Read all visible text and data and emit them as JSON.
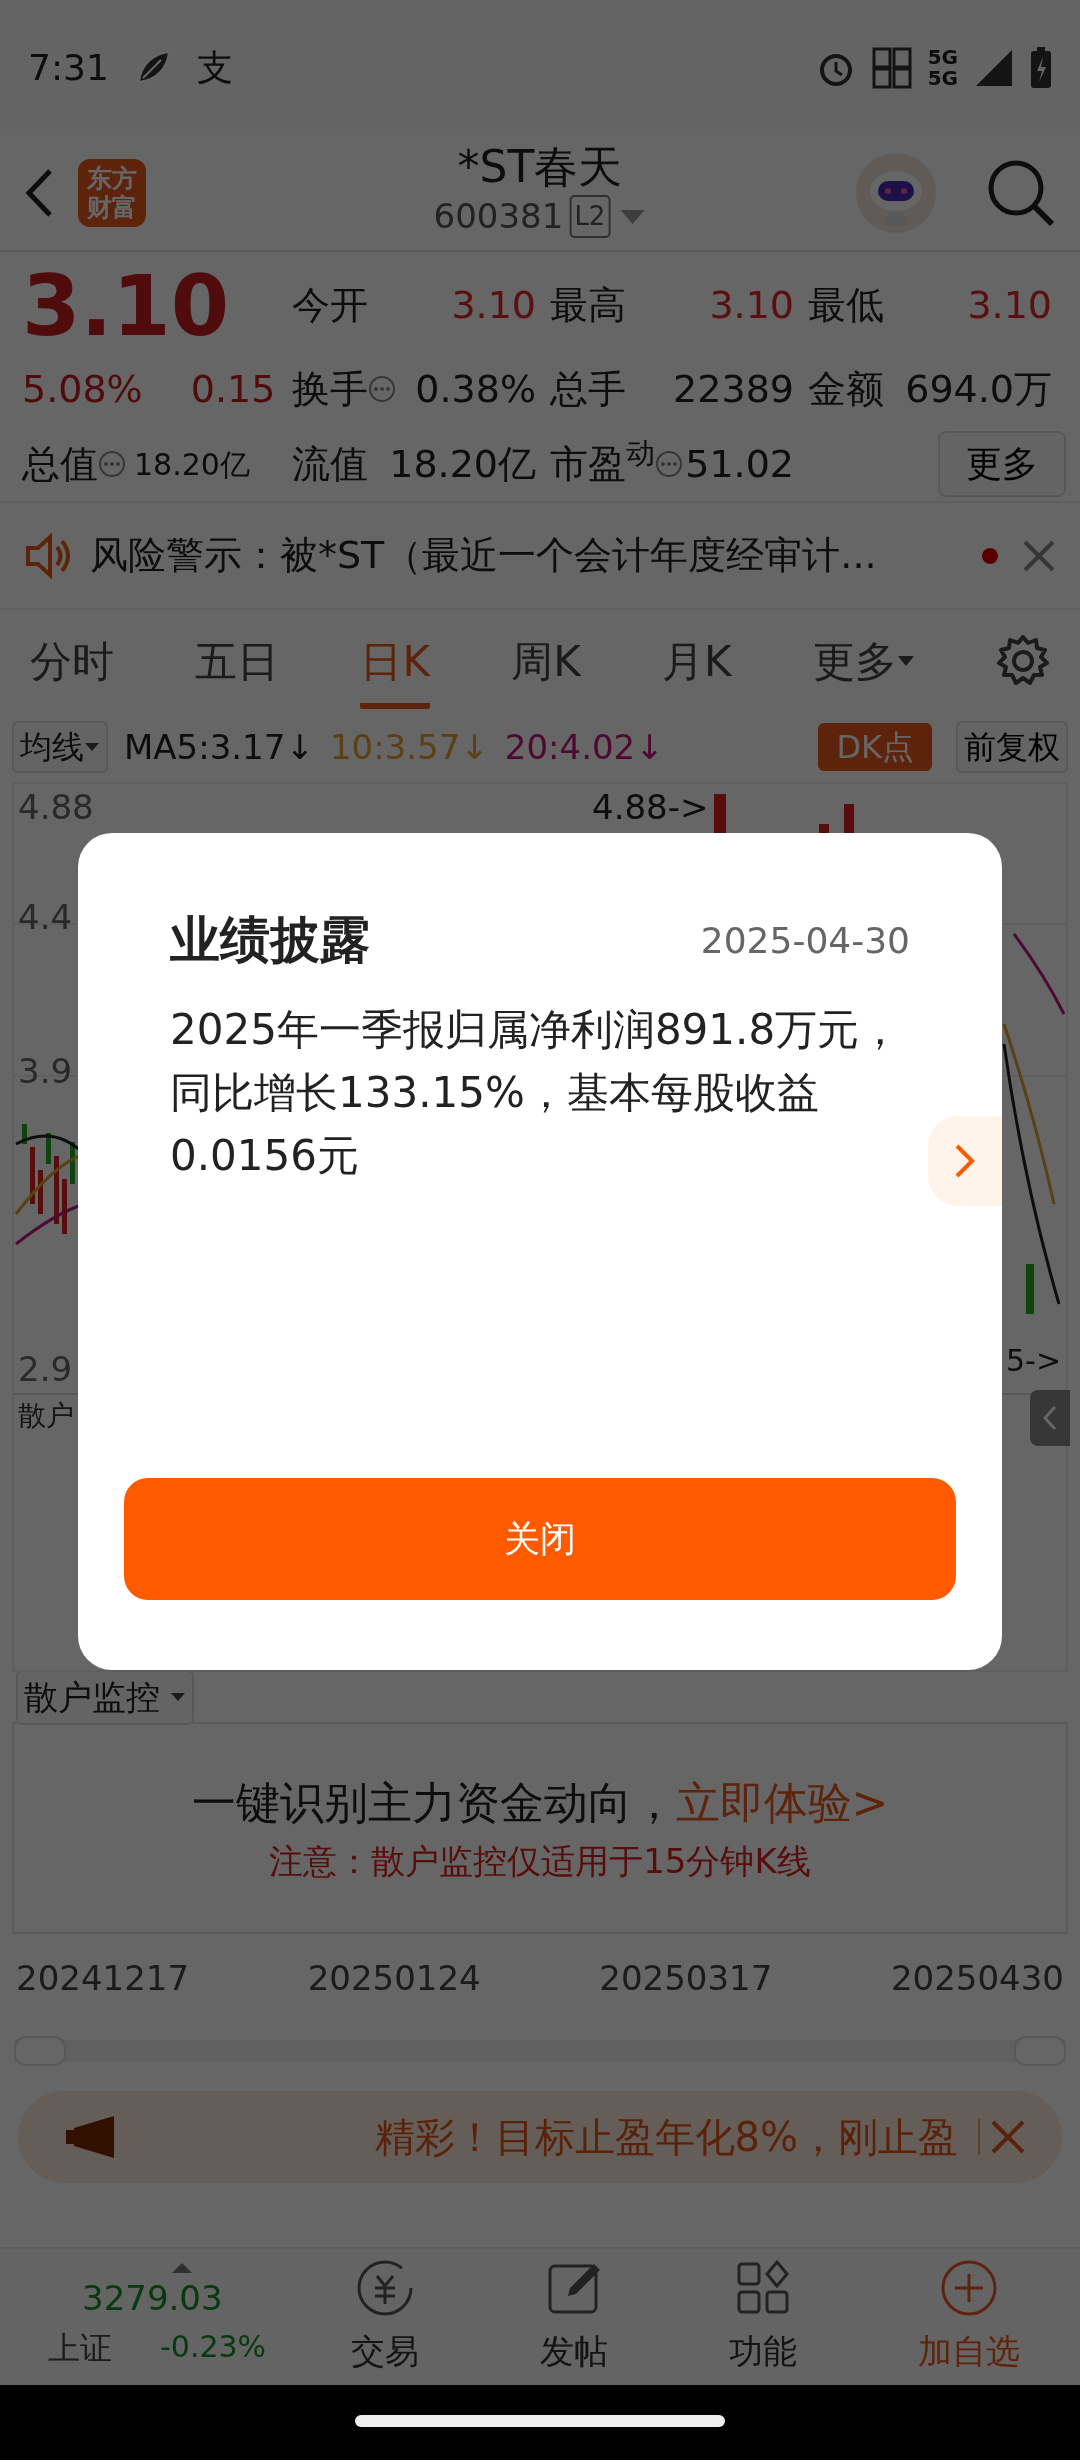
{
  "status_bar": {
    "time": "7:31",
    "app_glyph": "支",
    "network_top": "5G",
    "network_bottom": "5G"
  },
  "header": {
    "logo_lines": [
      "东方",
      "财富"
    ],
    "title": "*ST春天",
    "code": "600381",
    "level_badge": "L2"
  },
  "quote": {
    "price": "3.10",
    "change_pct": "5.08%",
    "change": "0.15",
    "total_value_label": "总值",
    "total_value": "18.20亿",
    "fields": [
      {
        "label": "今开",
        "value": "3.10",
        "rising": true,
        "info": false
      },
      {
        "label": "最高",
        "value": "3.10",
        "rising": true,
        "info": false
      },
      {
        "label": "最低",
        "value": "3.10",
        "rising": true,
        "info": false
      },
      {
        "label": "换手",
        "value": "0.38%",
        "rising": false,
        "info": true
      },
      {
        "label": "总手",
        "value": "22389",
        "rising": false,
        "info": false
      },
      {
        "label": "金额",
        "value": "694.0万",
        "rising": false,
        "info": false
      },
      {
        "label": "流值",
        "value": "18.20亿",
        "rising": false,
        "info": false
      },
      {
        "label": "市盈$^{动}$",
        "value": "51.02",
        "rising": false,
        "info": true
      }
    ],
    "more_button": "更多"
  },
  "notice": {
    "text": "风险警示：被*ST（最近一个会计年度经审计...",
    "unread": true
  },
  "period_tabs": [
    {
      "label": "分时",
      "selected": false,
      "dropdown": false
    },
    {
      "label": "五日",
      "selected": false,
      "dropdown": false
    },
    {
      "label": "日K",
      "selected": true,
      "dropdown": false
    },
    {
      "label": "周K",
      "selected": false,
      "dropdown": false
    },
    {
      "label": "月K",
      "selected": false,
      "dropdown": false
    },
    {
      "label": "更多",
      "selected": false,
      "dropdown": true
    }
  ],
  "chart_toolbar": {
    "indicator": "均线",
    "ma": [
      {
        "label": "MA5:3.17↓",
        "kind": "ma5"
      },
      {
        "label": "10:3.57↓",
        "kind": "ma10"
      },
      {
        "label": "20:4.02↓",
        "kind": "ma20"
      }
    ],
    "dk_button": "DK点",
    "adjust_button": "前复权"
  },
  "chart": {
    "y_labels": [
      "4.88",
      "4.4",
      "3.9",
      "2.9"
    ],
    "high_marker": "4.88->",
    "low_marker": "5->",
    "sub_indicator": "散户"
  },
  "monitor": {
    "dropdown": "散户监控",
    "headline": "一键识别主力资金动向，",
    "link": "立即体验>",
    "note": "注意：散户监控仅适用于15分钟K线"
  },
  "dates": [
    "20241217",
    "20250124",
    "20250317",
    "20250430"
  ],
  "banner": {
    "text": "精彩！目标止盈年化8%，刚止盈"
  },
  "bottom_nav": {
    "index_value": "3279.03",
    "index_name": "上证",
    "index_change": "-0.23%",
    "items": [
      {
        "label": "交易",
        "accent": false
      },
      {
        "label": "发帖",
        "accent": false
      },
      {
        "label": "功能",
        "accent": false
      },
      {
        "label": "加自选",
        "accent": true
      }
    ]
  },
  "dialog": {
    "title": "业绩披露",
    "date": "2025-04-30",
    "body": "2025年一季报归属净利润891.8万元，同比增长133.15%，基本每股收益0.0156元",
    "close_button": "关闭"
  }
}
